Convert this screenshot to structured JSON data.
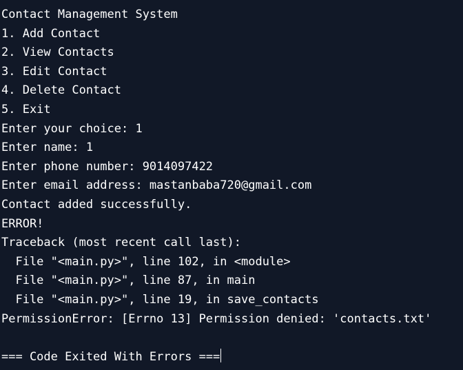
{
  "terminal": {
    "lines": [
      "Contact Management System",
      "1. Add Contact",
      "2. View Contacts",
      "3. Edit Contact",
      "4. Delete Contact",
      "5. Exit",
      "Enter your choice: 1",
      "Enter name: 1",
      "Enter phone number: 9014097422",
      "Enter email address: mastanbaba720@gmail.com",
      "Contact added successfully.",
      "ERROR!",
      "Traceback (most recent call last):",
      "  File \"<main.py>\", line 102, in <module>",
      "  File \"<main.py>\", line 87, in main",
      "  File \"<main.py>\", line 19, in save_contacts",
      "PermissionError: [Errno 13] Permission denied: 'contacts.txt'",
      "",
      "=== Code Exited With Errors ==="
    ]
  }
}
